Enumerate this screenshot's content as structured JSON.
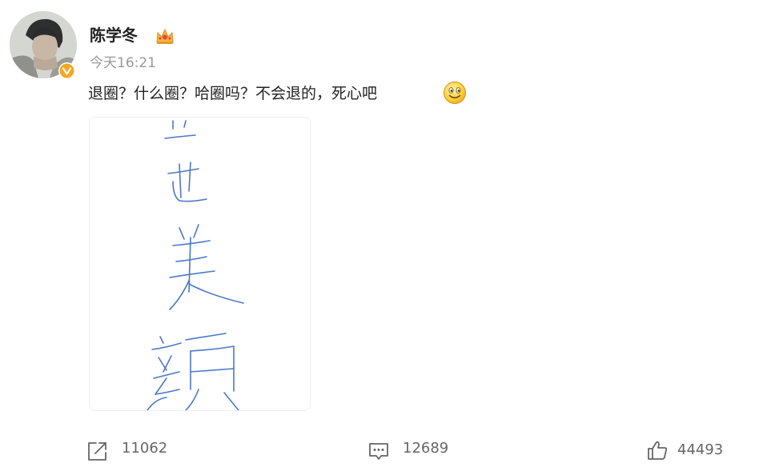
{
  "post": {
    "author": {
      "name": "陈学冬",
      "verified": true,
      "badge_color": "#f5a623"
    },
    "time": "今天16:21",
    "text": "退圈？什么圈？哈圈吗？不会退的，死心吧",
    "emoji": "smile-emoji",
    "image": {
      "kind": "handwritten-note",
      "ink_color": "#4a78c8"
    }
  },
  "actions": {
    "repost": {
      "icon": "share-icon",
      "count": "11062"
    },
    "comment": {
      "icon": "comment-icon",
      "count": "12689"
    },
    "like": {
      "icon": "thumbs-up-icon",
      "count": "44493"
    }
  },
  "colors": {
    "name": "#222222",
    "meta": "#999999",
    "counts": "#666666"
  }
}
